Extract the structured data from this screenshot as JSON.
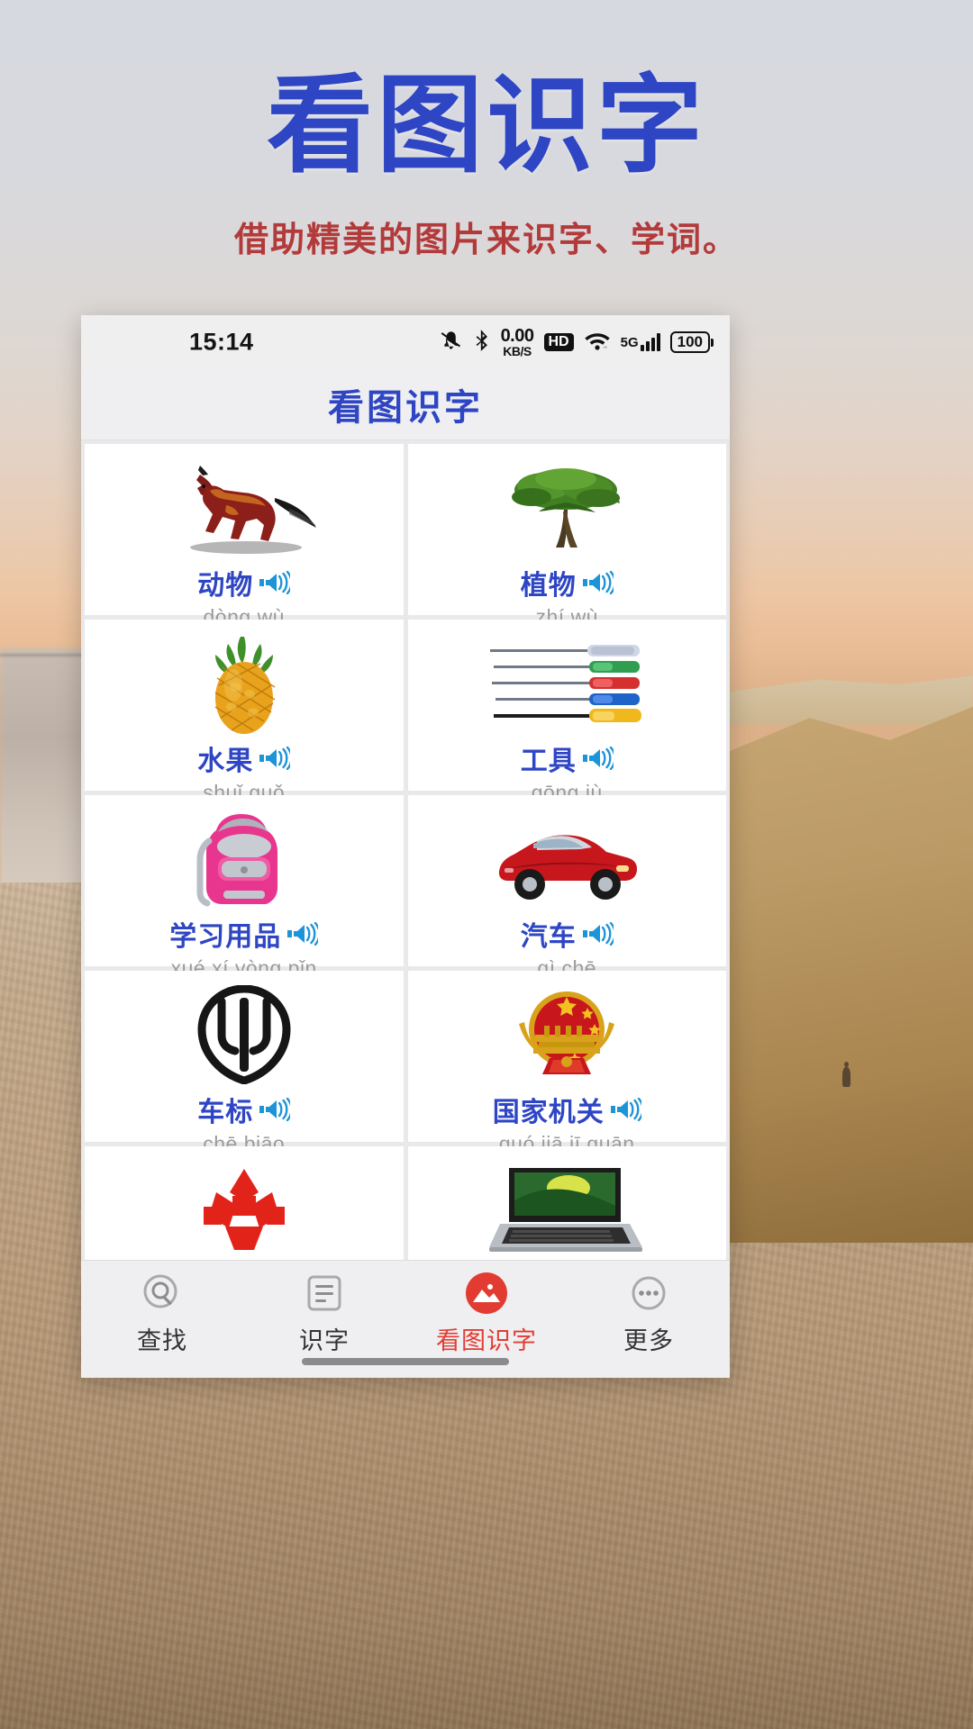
{
  "promo": {
    "title": "看图识字",
    "subtitle": "借助精美的图片来识字、学词。",
    "title_color": "#2e45c4",
    "subtitle_color": "#b33a3a"
  },
  "statusbar": {
    "time": "15:14",
    "icons": [
      "mute-icon",
      "bluetooth-icon",
      "hd-icon",
      "wifi-icon"
    ],
    "network_speed_value": "0.00",
    "network_speed_unit": "KB/S",
    "hd_label": "HD",
    "signal_label": "5G",
    "battery_level": "100"
  },
  "appbar": {
    "title": "看图识字",
    "title_color": "#2e45c4"
  },
  "grid": {
    "cards": [
      {
        "label": "动物",
        "pinyin": "dòng wù",
        "image": "horse"
      },
      {
        "label": "植物",
        "pinyin": "zhí wù",
        "image": "tree"
      },
      {
        "label": "水果",
        "pinyin": "shuǐ guǒ",
        "image": "pineapple"
      },
      {
        "label": "工具",
        "pinyin": "gōng jù",
        "image": "screwdrivers"
      },
      {
        "label": "学习用品",
        "pinyin": "xué xí yòng pǐn",
        "image": "backpack"
      },
      {
        "label": "汽车",
        "pinyin": "qì chē",
        "image": "red-car"
      },
      {
        "label": "车标",
        "pinyin": "chē biāo",
        "image": "car-emblem"
      },
      {
        "label": "国家机关",
        "pinyin": "guó jiā jī guān",
        "image": "national-emblem"
      },
      {
        "label": "",
        "pinyin": "",
        "image": "red-logo"
      },
      {
        "label": "",
        "pinyin": "",
        "image": "laptop"
      }
    ],
    "speaker_icon": "speaker-icon",
    "label_color": "#2e45c4",
    "pinyin_color": "#9b9b9b",
    "speaker_color": "#1e94d8"
  },
  "tabbar": {
    "items": [
      {
        "label": "查找",
        "icon": "search-icon",
        "active": false
      },
      {
        "label": "识字",
        "icon": "list-icon",
        "active": false
      },
      {
        "label": "看图识字",
        "icon": "picture-icon",
        "active": true
      },
      {
        "label": "更多",
        "icon": "more-icon",
        "active": false
      }
    ],
    "active_color": "#e23c32"
  }
}
